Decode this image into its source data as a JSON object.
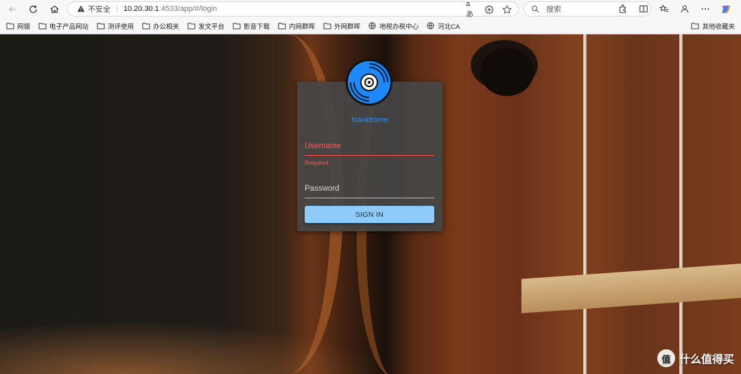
{
  "browser": {
    "address": {
      "insecure_label": "不安全",
      "url_host": "10.20.30.1",
      "url_rest": ":4533/app/#/login"
    },
    "search_placeholder": "搜索",
    "bookmarks": [
      {
        "label": "网银",
        "icon": "folder-icon"
      },
      {
        "label": "电子产品网站",
        "icon": "folder-icon"
      },
      {
        "label": "测评使用",
        "icon": "folder-icon"
      },
      {
        "label": "办公相关",
        "icon": "folder-icon"
      },
      {
        "label": "发文平台",
        "icon": "folder-icon"
      },
      {
        "label": "影音下载",
        "icon": "folder-icon"
      },
      {
        "label": "内网群晖",
        "icon": "folder-icon"
      },
      {
        "label": "外网群晖",
        "icon": "folder-icon"
      },
      {
        "label": "地税办税中心",
        "icon": "globe-icon"
      },
      {
        "label": "河北CA",
        "icon": "globe-icon"
      }
    ],
    "other_bookmarks": "其他收藏夹"
  },
  "login": {
    "app_name": "Navidrome",
    "username_label": "Username",
    "username_helper": "Required",
    "password_label": "Password",
    "signin_label": "SIGN IN",
    "accent_color": "#90caf9",
    "error_color": "#ff4d4d"
  },
  "watermark": {
    "badge": "值",
    "text": "什么值得买"
  }
}
